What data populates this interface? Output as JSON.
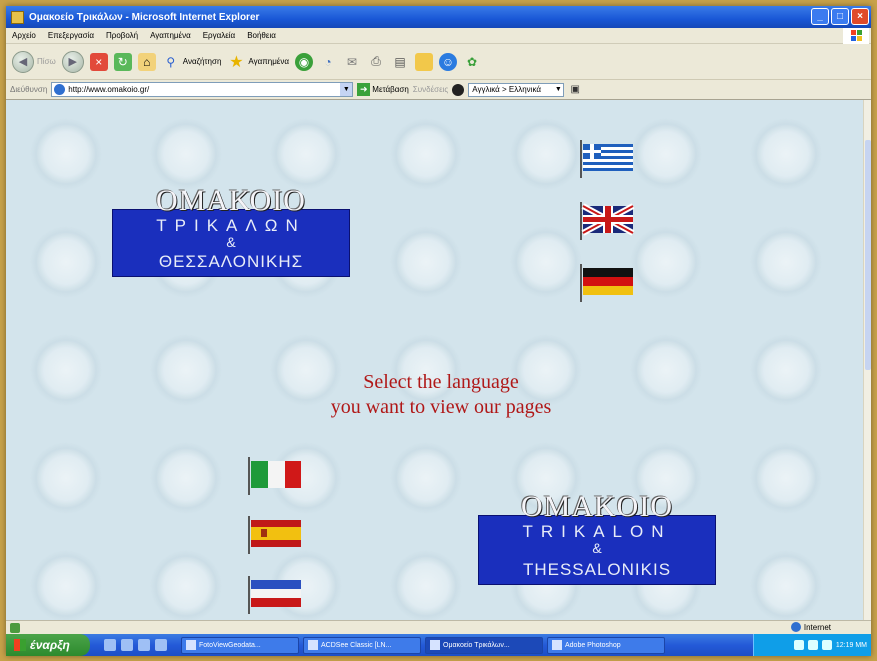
{
  "window": {
    "title": "Ομακοείο Τρικάλων - Microsoft Internet Explorer"
  },
  "menu": [
    "Αρχείο",
    "Επεξεργασία",
    "Προβολή",
    "Αγαπημένα",
    "Εργαλεία",
    "Βοήθεια"
  ],
  "toolbar": {
    "back_label": "Πίσω",
    "search_label": "Αναζήτηση",
    "favorites_label": "Αγαπημένα"
  },
  "addressbar": {
    "label": "Διεύθυνση",
    "url": "http://www.omakoio.gr/",
    "go_label": "Μετάβαση",
    "links_label": "Συνδέσεις",
    "translate_value": "Αγγλικά > Ελληνικά"
  },
  "page": {
    "logo_greek": {
      "line1": "ΟΜΑΚΟΙΟ",
      "line2": "ΤΡΙΚΑΛΩΝ",
      "line3": "&",
      "line4": "ΘΕΣΣΑΛΟΝΙΚΗΣ"
    },
    "logo_latin": {
      "line1": "OMAKOIO",
      "line2": "TRIKALON",
      "line3": "&",
      "line4": "THESSALONIKIS"
    },
    "prompt_line1": "Select the language",
    "prompt_line2": "you want to view our pages"
  },
  "flags": [
    "greek-flag",
    "uk-flag",
    "german-flag",
    "italian-flag",
    "spanish-flag",
    "serbian-flag"
  ],
  "statusbar": {
    "zone": "Internet"
  },
  "taskbar": {
    "start_label": "έναρξη",
    "tasks": [
      "FotoViewGeodata...",
      "ACDSee Classic [LN...",
      "Ομακοείο Τρικάλων...",
      "Adobe Photoshop"
    ],
    "clock": "12:19 ΜΜ"
  }
}
